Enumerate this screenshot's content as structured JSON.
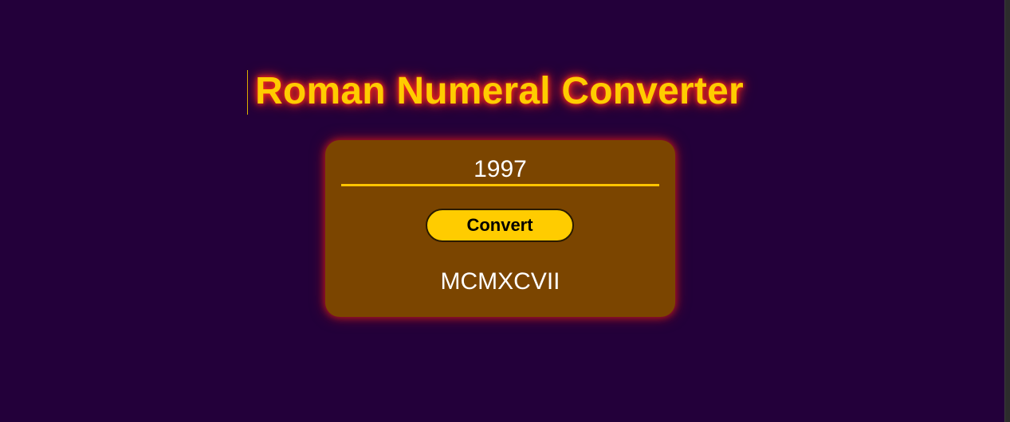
{
  "app": {
    "title": "Roman Numeral Converter"
  },
  "converter": {
    "input_value": "1997",
    "button_label": "Convert",
    "result": "MCMXCVII"
  },
  "colors": {
    "background": "#23003a",
    "card": "#7b4500",
    "accent": "#ffcc00",
    "glow": "#ff2a1a",
    "text": "#ffffff"
  }
}
